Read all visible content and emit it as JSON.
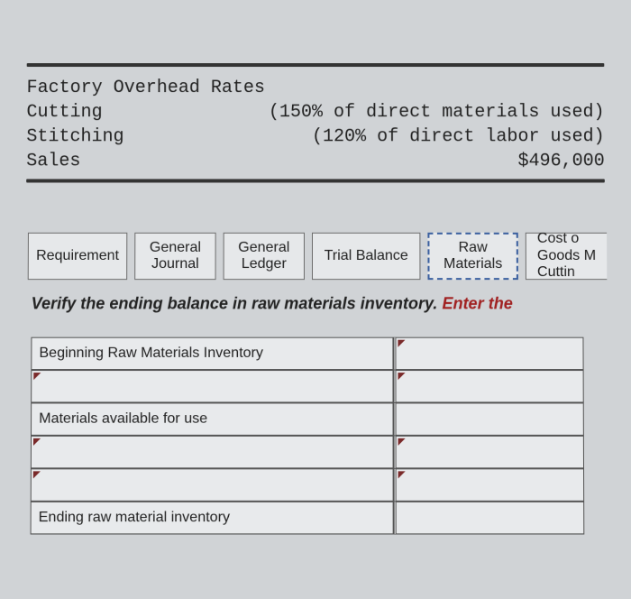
{
  "overhead": {
    "title": "Factory Overhead Rates",
    "rows": [
      {
        "label": "Cutting",
        "value": "(150% of direct materials used)"
      },
      {
        "label": "Stitching",
        "value": "(120% of direct labor used)"
      },
      {
        "label": "Sales",
        "value": "$496,000"
      }
    ]
  },
  "tabs": {
    "requirement": "Requirement",
    "general_journal_l1": "General",
    "general_journal_l2": "Journal",
    "general_ledger_l1": "General",
    "general_ledger_l2": "Ledger",
    "trial_balance": "Trial Balance",
    "raw_l1": "Raw",
    "raw_l2": "Materials",
    "cogm_l1": "Cost o",
    "cogm_l2": "Goods M",
    "cogm_l3": "Cuttin"
  },
  "instruction": {
    "lead": "Verify the ending balance in raw materials inventory. ",
    "enter": "Enter the"
  },
  "sheet": {
    "r1": "Beginning Raw Materials Inventory",
    "r3": "Materials available for use",
    "r6": "Ending raw material inventory"
  }
}
